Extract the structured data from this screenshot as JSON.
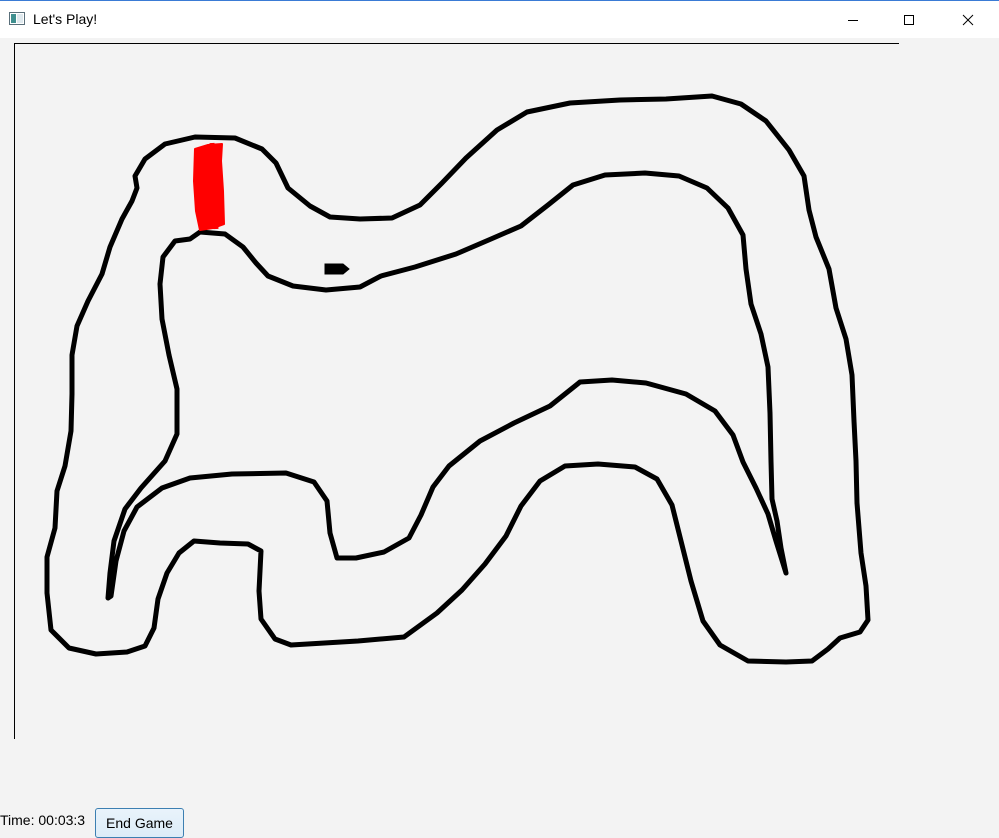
{
  "window": {
    "title": "Let's Play!",
    "controls": {
      "minimize_icon": "minimize-icon",
      "maximize_icon": "maximize-icon",
      "close_icon": "close-icon"
    }
  },
  "game": {
    "finish_line_color": "#ff0000",
    "track_color": "#000000",
    "canvas_background": "#f3f3f3"
  },
  "status": {
    "timer_text": "Time: 00:03:3",
    "end_button_label": "End Game"
  }
}
